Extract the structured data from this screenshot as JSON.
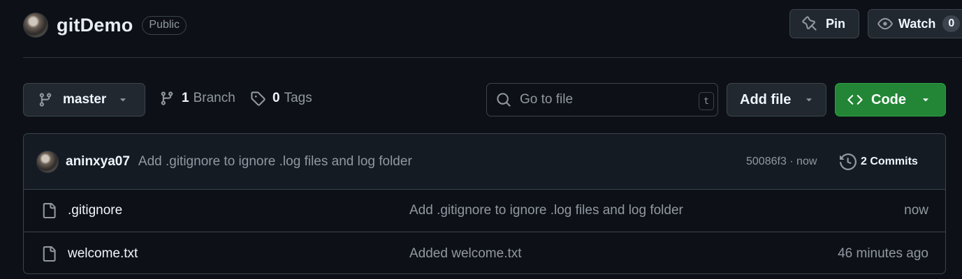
{
  "repo": {
    "name": "gitDemo",
    "visibility": "Public"
  },
  "header_actions": {
    "pin_label": "Pin",
    "watch_label": "Watch",
    "watch_count": "0"
  },
  "toolbar": {
    "branch_name": "master",
    "branch_count": "1",
    "branch_label": "Branch",
    "tag_count": "0",
    "tag_label": "Tags",
    "search_placeholder": "Go to file",
    "search_shortcut": "t",
    "add_file_label": "Add file",
    "code_label": "Code"
  },
  "latest_commit": {
    "author": "aninxya07",
    "message": "Add .gitignore to ignore .log files and log folder",
    "meta": "50086f3 · now",
    "commit_count": "2 Commits"
  },
  "files": [
    {
      "name": ".gitignore",
      "commit_message": "Add .gitignore to ignore .log files and log folder",
      "time": "now"
    },
    {
      "name": "welcome.txt",
      "commit_message": "Added welcome.txt",
      "time": "46 minutes ago"
    }
  ],
  "colors": {
    "background": "#0d1117",
    "code_button": "#238636",
    "border": "#3d444d"
  }
}
